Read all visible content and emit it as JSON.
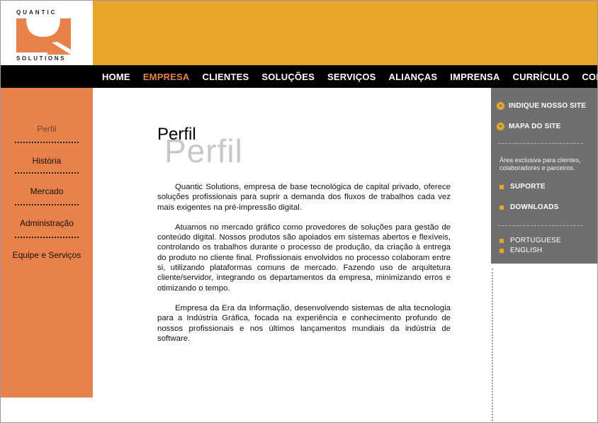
{
  "logo": {
    "top_text": "QUANTIC",
    "bottom_text": "SOLUTIONS"
  },
  "nav": {
    "items": [
      "HOME",
      "EMPRESA",
      "CLIENTES",
      "SOLUÇÕES",
      "SERVIÇOS",
      "ALIANÇAS",
      "IMPRENSA",
      "CURRÍCULO",
      "CONTATO"
    ],
    "active": "EMPRESA"
  },
  "sidebar": {
    "items": [
      "Perfil",
      "História",
      "Mercado",
      "Administração",
      "Equipe e Serviços"
    ],
    "active": "Perfil"
  },
  "content": {
    "title": "Perfil",
    "title_shadow": "Perfil",
    "paragraphs": [
      "Quantic Solutions, empresa de base tecnológica de capital privado, oferece soluções profissionais para suprir a demanda dos fluxos de trabalhos cada vez mais exigentes na pré-impressão digital.",
      "Atuamos no mercado gráfico como provedores de soluções para gestão de conteúdo digital. Nossos produtos são apoiados em sistemas abertos e flexíveis, controlando os trabalhos durante o processo de produção, da criação à entrega do produto no cliente final. Profissionais envolvidos no processo colaboram entre si, utilizando plataformas comuns de mercado. Fazendo uso de arquitetura cliente/servidor, integrando os departamentos da empresa, minimizando erros e otimizando o tempo.",
      "Empresa da Era da Informação, desenvolvendo sistemas de alta tecnologia para a Indústria Gráfica, focada na experiência e conhecimento profundo de nossos profissionais e nos últimos lançamentos mundiais da indústria de software."
    ]
  },
  "right_panel": {
    "indique": "INDIQUE NOSSO SITE",
    "mapa": "MAPA DO SITE",
    "note": "Área exclusiva para clientes, colaboradores e parceiros.",
    "suporte": "SUPORTE",
    "downloads": "DOWNLOADS",
    "portuguese": "PORTUGUESE",
    "english": "ENGLISH"
  },
  "colors": {
    "accent_orange": "#e8814a",
    "accent_yellow": "#e8a628",
    "panel_gray": "#6f6f6f",
    "nav_black": "#000000"
  }
}
